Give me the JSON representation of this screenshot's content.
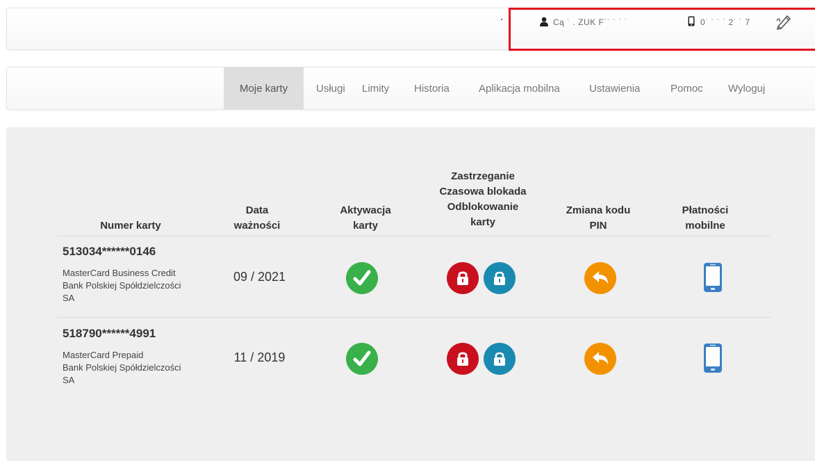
{
  "header": {
    "user_name": "Cą ˙ . ZUK F˙˙ ˙ ˙ ˙",
    "phone_number": "0˙ ˙ ˙ ˙ 2˙ ˙ 7",
    "highlight_color": "#e3101f"
  },
  "nav": {
    "items": [
      {
        "label": "Moje karty",
        "active": true
      },
      {
        "label": "Usługi",
        "active": false
      },
      {
        "label": "Limity",
        "active": false
      },
      {
        "label": "Historia",
        "active": false
      },
      {
        "label": "Aplikacja mobilna",
        "active": false
      },
      {
        "label": "Ustawienia",
        "active": false
      },
      {
        "label": "Pomoc",
        "active": false
      },
      {
        "label": "Wyloguj",
        "active": false
      }
    ]
  },
  "table": {
    "headers": {
      "card_number": "Numer karty",
      "expiry_line1": "Data",
      "expiry_line2": "ważności",
      "activation_line1": "Aktywacja",
      "activation_line2": "karty",
      "block_line1": "Zastrzeganie",
      "block_line2": "Czasowa blokada",
      "block_line3": "Odblokowanie",
      "block_line4": "karty",
      "pin_line1": "Zmiana kodu",
      "pin_line2": "PIN",
      "mobile_line1": "Płatności",
      "mobile_line2": "mobilne"
    },
    "rows": [
      {
        "card_number": "513034******0146",
        "card_type": "MasterCard Business Credit",
        "bank_line1": "Bank Polskiej Spółdzielczości",
        "bank_line2": "SA",
        "expiry": "09 / 2021"
      },
      {
        "card_number": "518790******4991",
        "card_type": "MasterCard Prepaid",
        "bank_line1": "Bank Polskiej Spółdzielczości",
        "bank_line2": "SA",
        "expiry": "11 / 2019"
      }
    ]
  },
  "icons": {
    "user": "user-icon",
    "phone": "phone-icon",
    "edit": "edit-icon",
    "activation": "check-icon",
    "block": "lock-icon",
    "unblock": "unlock-icon",
    "pin": "reply-arrow-icon",
    "mobile": "smartphone-icon"
  },
  "colors": {
    "green": "#39b04a",
    "red": "#c9101f",
    "blue": "#1b8ab0",
    "orange": "#f39200",
    "phone_blue": "#3a7fc4"
  }
}
